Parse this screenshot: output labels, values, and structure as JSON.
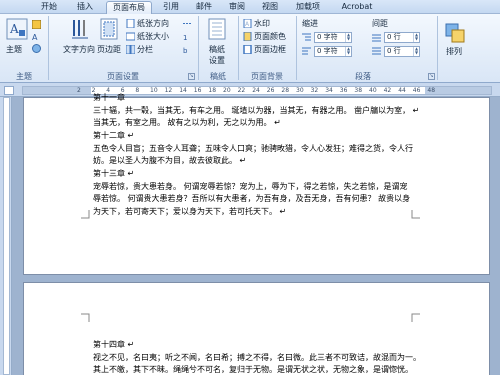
{
  "tabs": [
    {
      "label": "开始"
    },
    {
      "label": "插入"
    },
    {
      "label": "页面布局"
    },
    {
      "label": "引用"
    },
    {
      "label": "邮件"
    },
    {
      "label": "审阅"
    },
    {
      "label": "视图"
    },
    {
      "label": "加载项"
    },
    {
      "label": "Acrobat"
    }
  ],
  "ribbon": {
    "themes": {
      "label": "主题",
      "btn": "主题"
    },
    "page_setup": {
      "label": "页面设置",
      "text_direction": "文字方向",
      "margins": "页边距",
      "orientation": "纸张方向",
      "size": "纸张大小",
      "columns": "分栏"
    },
    "draft": {
      "label": "稿纸",
      "btn_line1": "稿纸",
      "btn_line2": "设置"
    },
    "page_background": {
      "label": "页面背景",
      "watermark": "水印",
      "page_color": "页面颜色",
      "page_borders": "页面边框"
    },
    "paragraph": {
      "label": "段落",
      "indent": "缩进",
      "spacing": "间距",
      "left_val": "0 字符",
      "right_val": "0 字符",
      "before_val": "0 行",
      "after_val": "0 行"
    },
    "arrange": {
      "label": "排列"
    }
  },
  "ruler_numbers": [
    "2",
    "2",
    "4",
    "6",
    "8",
    "10",
    "12",
    "14",
    "16",
    "18",
    "20",
    "22",
    "24",
    "26",
    "28",
    "30",
    "32",
    "34",
    "36",
    "38",
    "40",
    "42",
    "44",
    "46",
    "48"
  ],
  "doc": {
    "p1": [
      "第十一章",
      "三十辐，共一毂，当其无，有车之用。 埏埴以为器，当其无，有器之用。 凿户牖以为室，",
      "当其无，有室之用。 故有之以为利，无之以为用。",
      "第十二章",
      "五色令人目盲；五音令人耳聋；五味令人口爽；驰骋畋猎，令人心发狂；难得之货，令人行",
      "妨。是以圣人为腹不为目，故去彼取此。",
      "第十三章",
      "宠辱若惊，贵大患若身。 何谓宠辱若惊？宠为上，辱为下，得之若惊，失之若惊，是谓宠",
      "辱若惊。 何谓贵大患若身？吾所以有大患者，为吾有身，及吾无身，吾有何患？ 故贵以身",
      "为天下，若可寄天下；爱以身为天下，若可托天下。"
    ],
    "p2": [
      "第十四章",
      "视之不见，名曰夷；听之不闻，名曰希；搏之不得，名曰微。此三者不可致诘，故混而为一。",
      "其上不皦，其下不昧。绳绳兮不可名，复归于无物。是谓无状之状，无物之象，是谓惚恍。"
    ]
  },
  "colors": {
    "ribbon": "#dce8f7",
    "accent": "#2b579a",
    "page": "#ffffff",
    "workspace": "#9eb3cf"
  }
}
